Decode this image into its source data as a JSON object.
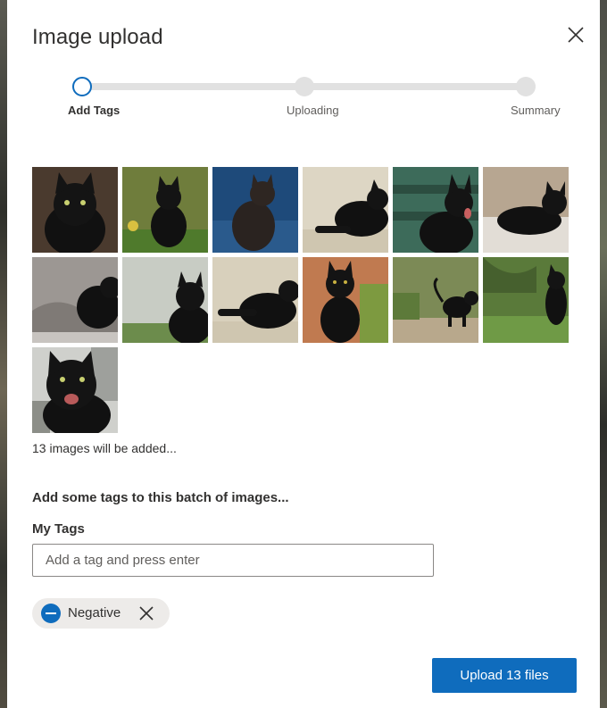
{
  "dialog": {
    "title": "Image upload",
    "close_icon": "close-icon"
  },
  "stepper": {
    "steps": [
      {
        "label": "Add Tags",
        "state": "active"
      },
      {
        "label": "Uploading",
        "state": "inactive"
      },
      {
        "label": "Summary",
        "state": "inactive"
      }
    ],
    "accent_color": "#0f6cbd"
  },
  "images": {
    "count": 13,
    "items": [
      {
        "alt": "black cat portrait, dark background"
      },
      {
        "alt": "black cat sitting on grass with flowers"
      },
      {
        "alt": "black cat on blue background"
      },
      {
        "alt": "black cat lying down, light background"
      },
      {
        "alt": "black cat yawning outdoors"
      },
      {
        "alt": "black cat lying on bed"
      },
      {
        "alt": "black cat on grey blanket"
      },
      {
        "alt": "black cat sitting on grass"
      },
      {
        "alt": "black cat lying down, light background"
      },
      {
        "alt": "black cat sitting on orange ground"
      },
      {
        "alt": "black cat walking on path"
      },
      {
        "alt": "black cat in grass field"
      },
      {
        "alt": "black cat hissing indoors"
      }
    ],
    "summary_text": "13 images will be added..."
  },
  "tags": {
    "heading": "Add some tags to this batch of images...",
    "field_label": "My Tags",
    "input_placeholder": "Add a tag and press enter",
    "input_value": "",
    "chips": [
      {
        "label": "Negative",
        "icon": "minus-circle-icon",
        "remove_icon": "close-icon"
      }
    ]
  },
  "footer": {
    "upload_label": "Upload 13 files"
  }
}
